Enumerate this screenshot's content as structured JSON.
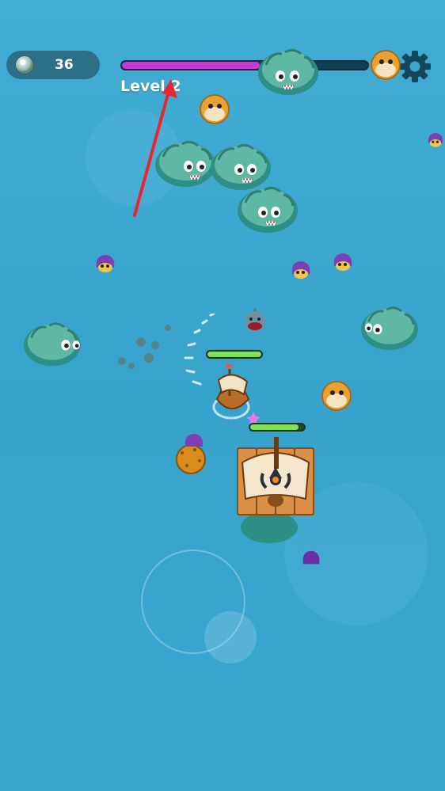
{
  "hud": {
    "pearl_count": "36",
    "level_label": "Level 2",
    "xp_progress": 0.56,
    "pearl_icon": "pearl-icon",
    "settings_icon": "gear-icon"
  },
  "player": {
    "health": 1.0
  },
  "raft": {
    "health": 0.9
  },
  "colors": {
    "ocean": "#3aa7cf",
    "xp_fill": "#c23ad0",
    "health_fill": "#7fe05b",
    "annotation_arrow": "#e8262f"
  }
}
